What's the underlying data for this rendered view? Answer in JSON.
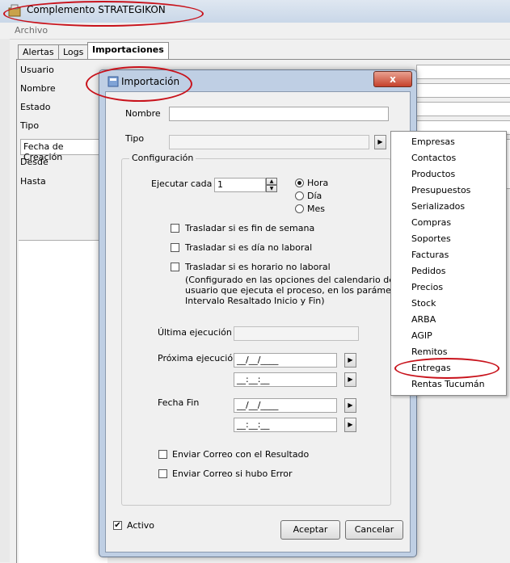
{
  "window": {
    "title": "Complemento STRATEGIKON"
  },
  "menubar": {
    "archivo": "Archivo"
  },
  "tabs": [
    "Alertas",
    "Logs",
    "Importaciones"
  ],
  "background_form": {
    "usuario": "Usuario",
    "nombre": "Nombre",
    "estado": "Estado",
    "tipo": "Tipo",
    "fecha_creacion": "Fecha de Creación",
    "desde": "Desde",
    "hasta": "Hasta"
  },
  "dialog": {
    "title": "Importación",
    "close": "x",
    "nombre_label": "Nombre",
    "nombre_value": "",
    "tipo_label": "Tipo",
    "tipo_value": "",
    "config_label": "Configuración",
    "ejecutar_label": "Ejecutar cada",
    "ejecutar_value": "1",
    "radio_hora": "Hora",
    "radio_dia": "Día",
    "radio_mes": "Mes",
    "selected_unit": "Hora",
    "chk1": "Trasladar si es fin de semana",
    "chk2": "Trasladar si es día no laboral",
    "chk3": "Trasladar si es horario no laboral",
    "note1": "(Configurado en las opciones del calendario del",
    "note2": "usuario que ejecuta el proceso, en los parámetros",
    "note3": "Intervalo Resaltado Inicio y Fin)",
    "ultima_label": "Última ejecución",
    "proxima_label": "Próxima ejecución",
    "proxima_date": "__/__/____",
    "proxima_time": "__:__:__",
    "fechafin_label": "Fecha Fin",
    "fechafin_date": "__/__/____",
    "fechafin_time": "__:__:__",
    "enviar_resultado": "Enviar Correo con el Resultado",
    "enviar_error": "Enviar Correo si hubo Error",
    "activo": "Activo",
    "activo_checked": true,
    "aceptar": "Aceptar",
    "cancelar": "Cancelar",
    "arrow_glyph": "▶",
    "check_glyph": "✔"
  },
  "tipo_menu": {
    "items": [
      "Empresas",
      "Contactos",
      "Productos",
      "Presupuestos",
      "Serializados",
      "Compras",
      "Soportes",
      "Facturas",
      "Pedidos",
      "Precios",
      "Stock",
      "ARBA",
      "AGIP",
      "Remitos",
      "Entregas",
      "Rentas Tucumán"
    ],
    "highlighted": "Entregas"
  }
}
